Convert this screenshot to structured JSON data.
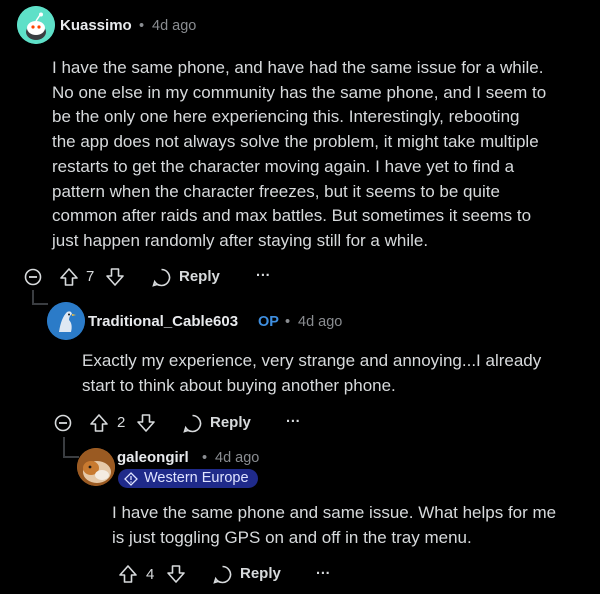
{
  "comments": [
    {
      "username": "Kuassimo",
      "age": "4d ago",
      "body": "I have the same phone, and have had the same issue for a while.\nNo one else in my community has the same phone, and I seem to\nbe the only one here experiencing this. Interestingly, rebooting\nthe app does not always solve the problem, it might take multiple\nrestarts to get the character moving again. I have yet to find a\npattern when the character freezes, but it seems to be quite\ncommon after raids and max battles. But sometimes it seems to\njust happen randomly after staying still for a while.",
      "votes": "7",
      "reply_label": "Reply",
      "more_label": "···"
    },
    {
      "username": "Traditional_Cable603",
      "op_badge": "OP",
      "age": "4d ago",
      "body": "Exactly my experience, very strange and annoying...I already\nstart to think about buying another phone.",
      "votes": "2",
      "reply_label": "Reply",
      "more_label": "···"
    },
    {
      "username": "galeongirl",
      "age": "4d ago",
      "flair": "Western Europe",
      "body": "I have the same phone and same issue. What helps for me\nis just toggling GPS on and off in the tray menu.",
      "votes": "4",
      "reply_label": "Reply",
      "more_label": "···"
    }
  ],
  "separator": "•",
  "colors": {
    "background": "#000000",
    "text": "#d7dadc",
    "muted": "#8a8d91",
    "op": "#3f8fe0",
    "flair_bg": "#1f2a8a"
  }
}
